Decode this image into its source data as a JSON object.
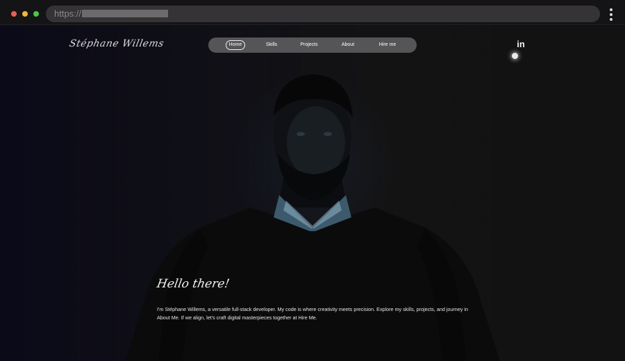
{
  "browser": {
    "url_scheme": "https://",
    "url_redacted": true
  },
  "site": {
    "logo": "Stéphane Willems",
    "nav": [
      {
        "label": "Home",
        "active": true
      },
      {
        "label": "Skills",
        "active": false
      },
      {
        "label": "Projects",
        "active": false
      },
      {
        "label": "About",
        "active": false
      },
      {
        "label": "Hire me",
        "active": false
      }
    ],
    "social": {
      "linkedin": "in"
    }
  },
  "hero": {
    "greeting": "Hello there!",
    "intro": "I'm Stéphane Willems, a versatile full-stack developer. My code is where creativity meets precision. Explore my skills, projects, and journey in About Me. If we align, let's craft digital masterpieces together at Hire Me."
  },
  "colors": {
    "background": "#121212",
    "nav_pill": "#555557",
    "text": "#f2f2f2"
  },
  "icons": [
    "linkedin-icon",
    "more-menu-icon"
  ]
}
